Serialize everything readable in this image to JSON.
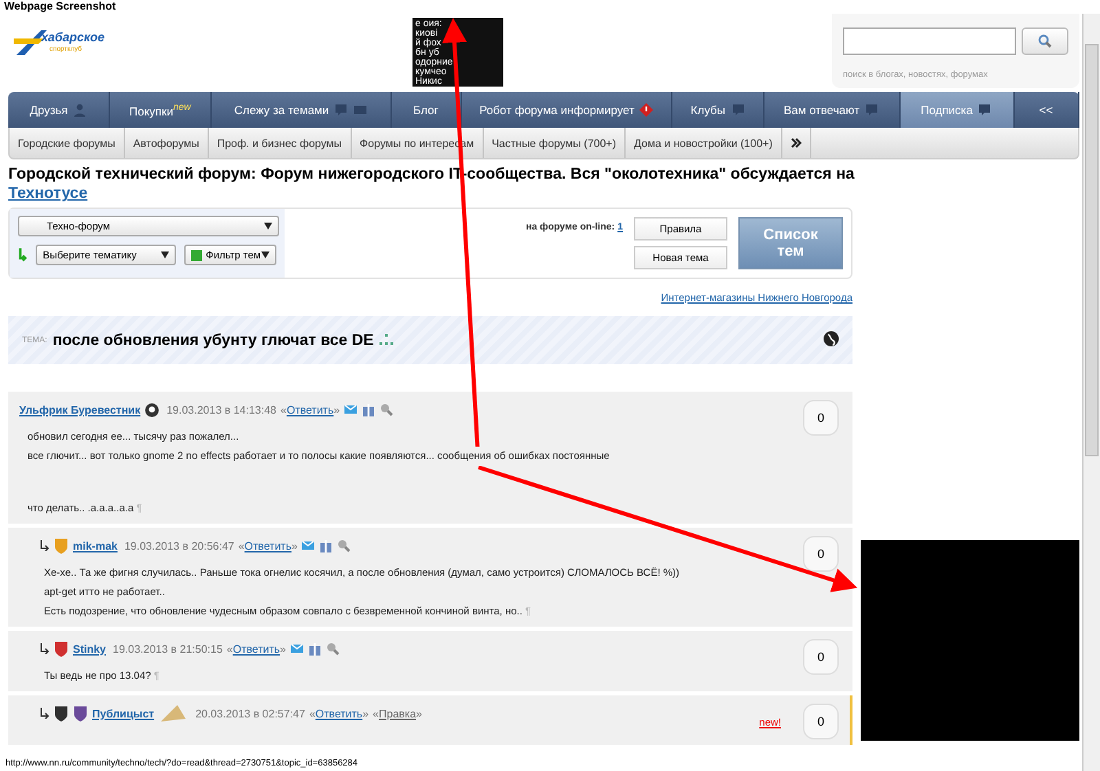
{
  "caption": "Webpage Screenshot",
  "header": {
    "logo_text": "хабарское",
    "logo_subtext": "спортклуб",
    "search": {
      "hint": "поиск в блогах, новостях, форумах"
    },
    "thumbnail_lines": [
      "е оия:",
      "киовi",
      "й фох",
      "бн уб",
      "одорние",
      "кумчео",
      "Никис"
    ]
  },
  "nav_tabs": [
    {
      "label": "Друзья",
      "kind": "user",
      "selected": false
    },
    {
      "label": "Покупки",
      "kind": "plain",
      "sup": "new",
      "selected": false
    },
    {
      "label": "Слежу за темами",
      "kind": "bubble-mail",
      "selected": false
    },
    {
      "label": "Блог",
      "kind": "plain",
      "selected": false
    },
    {
      "label": "Робот форума информирует",
      "kind": "alert",
      "selected": false
    },
    {
      "label": "Клубы",
      "kind": "bubble",
      "selected": false
    },
    {
      "label": "Вам отвечают",
      "kind": "bubble",
      "selected": false
    },
    {
      "label": "Подписка",
      "kind": "bubble",
      "selected": true
    },
    {
      "label": "<<",
      "kind": "plain",
      "selected": false
    }
  ],
  "sub_tabs": [
    "Городские форумы",
    "Автофорумы",
    "Проф. и бизнес форумы",
    "Форумы по интересам",
    "Частные форумы (700+)",
    "Дома и новостройки (100+)"
  ],
  "page_title": {
    "text": "Городской технический форум: Форум нижегородского IT-сообщества. Вся \"околотехника\" обсуждается на",
    "link": "Технотусе"
  },
  "panel": {
    "forum_select": "Техно-форум",
    "topic_select": "Выберите тематику",
    "filter": "Фильтр тем",
    "online_label": "на форуме on-line:",
    "online_count": "1",
    "rules": "Правила",
    "new_topic": "Новая тема",
    "topics_list": "Список тем"
  },
  "shops_link": "Интернет-магазины Нижнего Новгорода",
  "topic": {
    "prefix": "ТЕМА:",
    "title": "после обновления убунту глючат все DE"
  },
  "posts": [
    {
      "author": "Ульфрик Буревестник",
      "date": "19.03.2013 в 14:13:48",
      "actions": [
        {
          "open": "«",
          "label": "Ответить",
          "close": "»"
        }
      ],
      "rating": "0",
      "end_mark": "¶",
      "paragraphs": [
        [
          "обновил сегодня ее... тысячу раз пожалел...",
          "все глючит... вот только gnome 2 no effects работает и то полосы какие появляются... сообщения об ошибках постоянные"
        ],
        [
          "что делать.. .а.а.а..а.а"
        ]
      ],
      "children": [
        {
          "author": "mik-mak",
          "date": "19.03.2013 в 20:56:47",
          "actions": [
            {
              "open": "«",
              "label": "Ответить",
              "close": "»"
            }
          ],
          "rating": "0",
          "end_mark": "¶",
          "badges": [
            {
              "color": "#e8a020"
            }
          ],
          "paragraphs": [
            [
              "Хе-хе.. Та же фигня случилась.. Раньше тока огнелис косячил, а после обновления (думал, само устроится) СЛОМАЛОСЬ ВСЁ! %))",
              "apt-get итто не работает..",
              "Есть подозрение, что обновление чудесным образом совпало с безвременной кончиной винта, но.."
            ]
          ]
        },
        {
          "author": "Stinky",
          "date": "19.03.2013 в 21:50:15",
          "actions": [
            {
              "open": "«",
              "label": "Ответить",
              "close": "»"
            }
          ],
          "rating": "0",
          "end_mark": "¶",
          "badges": [
            {
              "color": "#d03030"
            }
          ],
          "paragraphs": [
            [
              "Ты ведь не про 13.04?"
            ]
          ]
        },
        {
          "author": "Публицыст",
          "date": "20.03.2013 в 02:57:47",
          "actions": [
            {
              "open": "«",
              "label": "Ответить",
              "close": "»"
            },
            {
              "open": "«",
              "label": "Правка",
              "close": "»"
            }
          ],
          "rating": "0",
          "new_badge": "new!",
          "badges": [
            {
              "color": "#303030"
            },
            {
              "color": "#6a4a9a"
            }
          ]
        }
      ]
    }
  ],
  "status_bar": "http://www.nn.ru/community/techno/tech/?do=read&thread=2730751&topic_id=63856284"
}
